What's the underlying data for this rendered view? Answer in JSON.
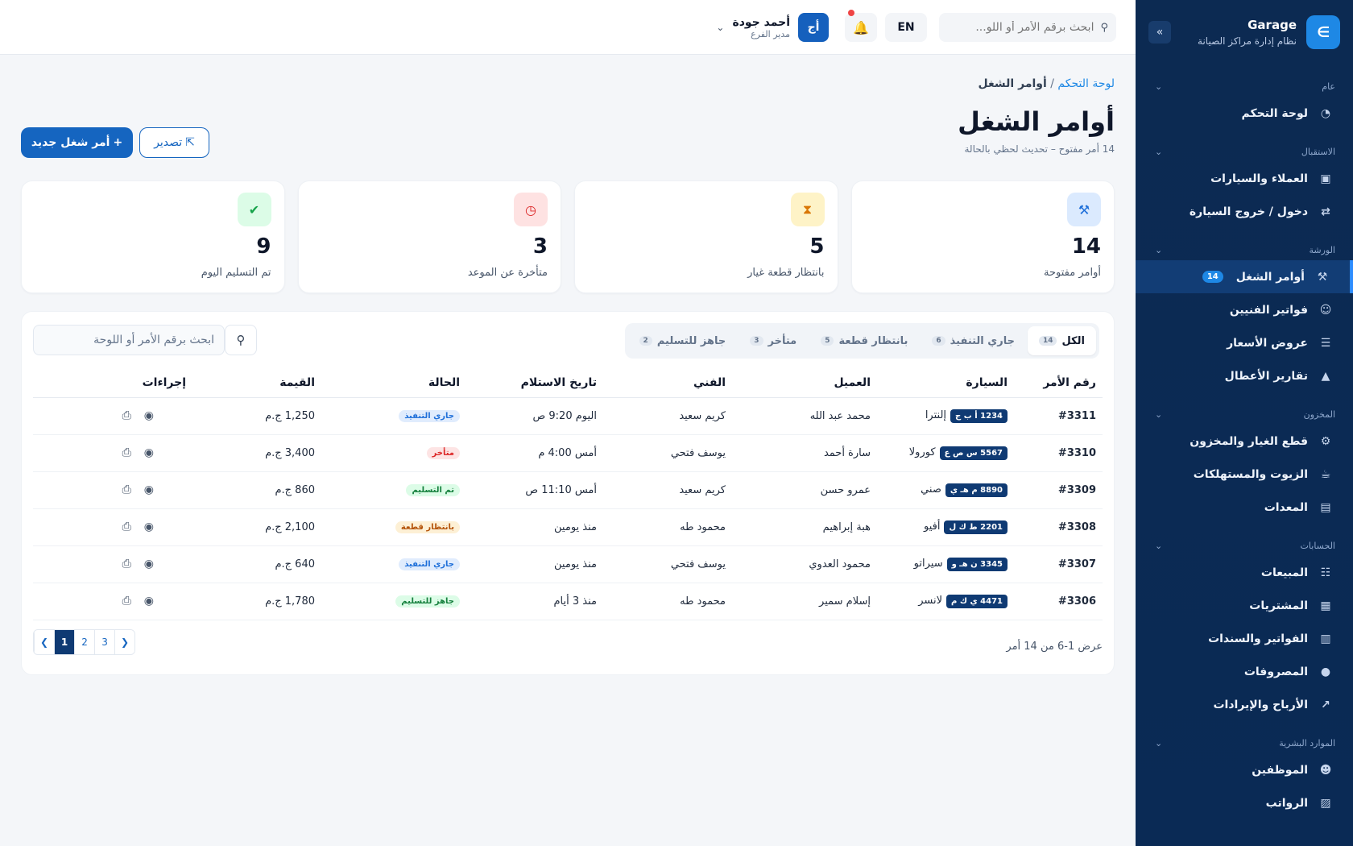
{
  "sidebar": {
    "brand_title": "Garage",
    "brand_subtitle": "نظام إدارة مراكز الصيانة",
    "groups": [
      {
        "label": "عام",
        "items": [
          {
            "label": "لوحة التحكم",
            "icon": "dashboard-icon"
          }
        ]
      },
      {
        "label": "الاستقبال",
        "items": [
          {
            "label": "العملاء والسيارات",
            "icon": "contacts-icon"
          },
          {
            "label": "دخول / خروج السيارة",
            "icon": "swap-icon"
          }
        ]
      },
      {
        "label": "الورشة",
        "items": [
          {
            "label": "أوامر الشغل",
            "icon": "wrench-icon",
            "badge": "14",
            "active": true
          },
          {
            "label": "فواتير الفنيين",
            "icon": "technician-icon"
          },
          {
            "label": "عروض الأسعار",
            "icon": "quote-icon"
          },
          {
            "label": "تقارير الأعطال",
            "icon": "warning-icon"
          }
        ]
      },
      {
        "label": "المخزون",
        "items": [
          {
            "label": "قطع الغيار والمخزون",
            "icon": "gears-icon"
          },
          {
            "label": "الزيوت والمستهلكات",
            "icon": "oil-can-icon"
          },
          {
            "label": "المعدات",
            "icon": "toolbox-icon"
          }
        ]
      },
      {
        "label": "الحسابات",
        "items": [
          {
            "label": "المبيعات",
            "icon": "cart-icon"
          },
          {
            "label": "المشتريات",
            "icon": "truck-icon"
          },
          {
            "label": "الفواتير والسندات",
            "icon": "invoice-icon"
          },
          {
            "label": "المصروفات",
            "icon": "money-bag-icon"
          },
          {
            "label": "الأرباح والإيرادات",
            "icon": "chart-icon"
          }
        ]
      },
      {
        "label": "الموارد البشرية",
        "items": [
          {
            "label": "الموظفين",
            "icon": "users-icon"
          },
          {
            "label": "الرواتب",
            "icon": "payroll-icon"
          }
        ]
      }
    ]
  },
  "topbar": {
    "search_placeholder": "ابحث برقم الأمر أو اللو...",
    "lang": "EN",
    "user_initials": "أج",
    "user_name": "أحمد جودة",
    "user_role": "مدير الفرع"
  },
  "page": {
    "crumb_parent": "لوحة التحكم",
    "crumb_sep": " / ",
    "crumb_current": "أوامر الشغل",
    "title": "أوامر الشغل",
    "subtitle": "14 أمر مفتوح – تحديث لحظي بالحالة",
    "new_button": "أمر شغل جديد",
    "export_button": "تصدير"
  },
  "stats": [
    {
      "value": "14",
      "label": "أوامر مفتوحة",
      "icon": "wrench-icon",
      "bg": "#dbeafe",
      "fg": "#1e6fd9"
    },
    {
      "value": "5",
      "label": "بانتظار قطعة غيار",
      "icon": "hourglass-icon",
      "bg": "#fef3c7",
      "fg": "#d97706"
    },
    {
      "value": "3",
      "label": "متأخرة عن الموعد",
      "icon": "clock-icon",
      "bg": "#fee2e2",
      "fg": "#dc2626"
    },
    {
      "value": "9",
      "label": "تم التسليم اليوم",
      "icon": "check-circle-icon",
      "bg": "#dcfce7",
      "fg": "#16a34a"
    }
  ],
  "tabs": [
    {
      "label": "الكل",
      "count": "14",
      "active": true
    },
    {
      "label": "جاري التنفيذ",
      "count": "6"
    },
    {
      "label": "بانتظار قطعة",
      "count": "5"
    },
    {
      "label": "متأخر",
      "count": "3"
    },
    {
      "label": "جاهز للتسليم",
      "count": "2"
    }
  ],
  "table_search_placeholder": "ابحث برقم الأمر أو اللوحة",
  "columns": [
    "رقم الأمر",
    "السيارة",
    "العميل",
    "الفني",
    "تاريخ الاستلام",
    "الحالة",
    "القيمة",
    "إجراءات"
  ],
  "rows": [
    {
      "order": "#3311",
      "plate": "1234 أ ب ج",
      "car": "إلنترا",
      "client": "محمد عبد الله",
      "tech": "كريم سعيد",
      "date": "اليوم 9:20 ص",
      "status": "جاري التنفيذ",
      "status_bg": "#e0ecfd",
      "status_fg": "#1e6fd9",
      "amount": "1,250 ج.م"
    },
    {
      "order": "#3310",
      "plate": "5567 س ص ع",
      "car": "كورولا",
      "client": "سارة أحمد",
      "tech": "يوسف فتحي",
      "date": "أمس 4:00 م",
      "status": "متأخر",
      "status_bg": "#fde4e4",
      "status_fg": "#dc2626",
      "amount": "3,400 ج.م"
    },
    {
      "order": "#3309",
      "plate": "8890 م هـ ي",
      "car": "صني",
      "client": "عمرو حسن",
      "tech": "كريم سعيد",
      "date": "أمس 11:10 ص",
      "status": "تم التسليم",
      "status_bg": "#dcfce7",
      "status_fg": "#15803d",
      "amount": "860 ج.م"
    },
    {
      "order": "#3308",
      "plate": "2201 ط ك ل",
      "car": "أفيو",
      "client": "هبة إبراهيم",
      "tech": "محمود طه",
      "date": "منذ يومين",
      "status": "بانتظار قطعة",
      "status_bg": "#fdf0d5",
      "status_fg": "#b45309",
      "amount": "2,100 ج.م"
    },
    {
      "order": "#3307",
      "plate": "3345 ن هـ و",
      "car": "سيراتو",
      "client": "محمود العدوي",
      "tech": "يوسف فتحي",
      "date": "منذ يومين",
      "status": "جاري التنفيذ",
      "status_bg": "#e0ecfd",
      "status_fg": "#1e6fd9",
      "amount": "640 ج.م"
    },
    {
      "order": "#3306",
      "plate": "4471 ي ك م",
      "car": "لانسر",
      "client": "إسلام سمير",
      "tech": "محمود طه",
      "date": "منذ 3 أيام",
      "status": "جاهز للتسليم",
      "status_bg": "#dcfce7",
      "status_fg": "#15803d",
      "amount": "1,780 ج.م"
    }
  ],
  "pager": {
    "info": "عرض 1-6 من 14 أمر",
    "pages": [
      "1",
      "2",
      "3"
    ],
    "current": "1"
  }
}
